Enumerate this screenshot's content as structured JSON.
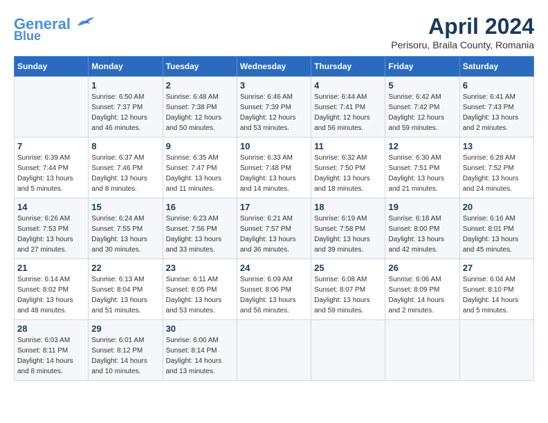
{
  "header": {
    "logo_line1": "General",
    "logo_line2": "Blue",
    "month_title": "April 2024",
    "subtitle": "Perisoru, Braila County, Romania"
  },
  "days_of_week": [
    "Sunday",
    "Monday",
    "Tuesday",
    "Wednesday",
    "Thursday",
    "Friday",
    "Saturday"
  ],
  "weeks": [
    [
      {
        "day": "",
        "info": ""
      },
      {
        "day": "1",
        "info": "Sunrise: 6:50 AM\nSunset: 7:37 PM\nDaylight: 12 hours\nand 46 minutes."
      },
      {
        "day": "2",
        "info": "Sunrise: 6:48 AM\nSunset: 7:38 PM\nDaylight: 12 hours\nand 50 minutes."
      },
      {
        "day": "3",
        "info": "Sunrise: 6:46 AM\nSunset: 7:39 PM\nDaylight: 12 hours\nand 53 minutes."
      },
      {
        "day": "4",
        "info": "Sunrise: 6:44 AM\nSunset: 7:41 PM\nDaylight: 12 hours\nand 56 minutes."
      },
      {
        "day": "5",
        "info": "Sunrise: 6:42 AM\nSunset: 7:42 PM\nDaylight: 12 hours\nand 59 minutes."
      },
      {
        "day": "6",
        "info": "Sunrise: 6:41 AM\nSunset: 7:43 PM\nDaylight: 13 hours\nand 2 minutes."
      }
    ],
    [
      {
        "day": "7",
        "info": "Sunrise: 6:39 AM\nSunset: 7:44 PM\nDaylight: 13 hours\nand 5 minutes."
      },
      {
        "day": "8",
        "info": "Sunrise: 6:37 AM\nSunset: 7:46 PM\nDaylight: 13 hours\nand 8 minutes."
      },
      {
        "day": "9",
        "info": "Sunrise: 6:35 AM\nSunset: 7:47 PM\nDaylight: 13 hours\nand 11 minutes."
      },
      {
        "day": "10",
        "info": "Sunrise: 6:33 AM\nSunset: 7:48 PM\nDaylight: 13 hours\nand 14 minutes."
      },
      {
        "day": "11",
        "info": "Sunrise: 6:32 AM\nSunset: 7:50 PM\nDaylight: 13 hours\nand 18 minutes."
      },
      {
        "day": "12",
        "info": "Sunrise: 6:30 AM\nSunset: 7:51 PM\nDaylight: 13 hours\nand 21 minutes."
      },
      {
        "day": "13",
        "info": "Sunrise: 6:28 AM\nSunset: 7:52 PM\nDaylight: 13 hours\nand 24 minutes."
      }
    ],
    [
      {
        "day": "14",
        "info": "Sunrise: 6:26 AM\nSunset: 7:53 PM\nDaylight: 13 hours\nand 27 minutes."
      },
      {
        "day": "15",
        "info": "Sunrise: 6:24 AM\nSunset: 7:55 PM\nDaylight: 13 hours\nand 30 minutes."
      },
      {
        "day": "16",
        "info": "Sunrise: 6:23 AM\nSunset: 7:56 PM\nDaylight: 13 hours\nand 33 minutes."
      },
      {
        "day": "17",
        "info": "Sunrise: 6:21 AM\nSunset: 7:57 PM\nDaylight: 13 hours\nand 36 minutes."
      },
      {
        "day": "18",
        "info": "Sunrise: 6:19 AM\nSunset: 7:58 PM\nDaylight: 13 hours\nand 39 minutes."
      },
      {
        "day": "19",
        "info": "Sunrise: 6:18 AM\nSunset: 8:00 PM\nDaylight: 13 hours\nand 42 minutes."
      },
      {
        "day": "20",
        "info": "Sunrise: 6:16 AM\nSunset: 8:01 PM\nDaylight: 13 hours\nand 45 minutes."
      }
    ],
    [
      {
        "day": "21",
        "info": "Sunrise: 6:14 AM\nSunset: 8:02 PM\nDaylight: 13 hours\nand 48 minutes."
      },
      {
        "day": "22",
        "info": "Sunrise: 6:13 AM\nSunset: 8:04 PM\nDaylight: 13 hours\nand 51 minutes."
      },
      {
        "day": "23",
        "info": "Sunrise: 6:11 AM\nSunset: 8:05 PM\nDaylight: 13 hours\nand 53 minutes."
      },
      {
        "day": "24",
        "info": "Sunrise: 6:09 AM\nSunset: 8:06 PM\nDaylight: 13 hours\nand 56 minutes."
      },
      {
        "day": "25",
        "info": "Sunrise: 6:08 AM\nSunset: 8:07 PM\nDaylight: 13 hours\nand 59 minutes."
      },
      {
        "day": "26",
        "info": "Sunrise: 6:06 AM\nSunset: 8:09 PM\nDaylight: 14 hours\nand 2 minutes."
      },
      {
        "day": "27",
        "info": "Sunrise: 6:04 AM\nSunset: 8:10 PM\nDaylight: 14 hours\nand 5 minutes."
      }
    ],
    [
      {
        "day": "28",
        "info": "Sunrise: 6:03 AM\nSunset: 8:11 PM\nDaylight: 14 hours\nand 8 minutes."
      },
      {
        "day": "29",
        "info": "Sunrise: 6:01 AM\nSunset: 8:12 PM\nDaylight: 14 hours\nand 10 minutes."
      },
      {
        "day": "30",
        "info": "Sunrise: 6:00 AM\nSunset: 8:14 PM\nDaylight: 14 hours\nand 13 minutes."
      },
      {
        "day": "",
        "info": ""
      },
      {
        "day": "",
        "info": ""
      },
      {
        "day": "",
        "info": ""
      },
      {
        "day": "",
        "info": ""
      }
    ]
  ]
}
